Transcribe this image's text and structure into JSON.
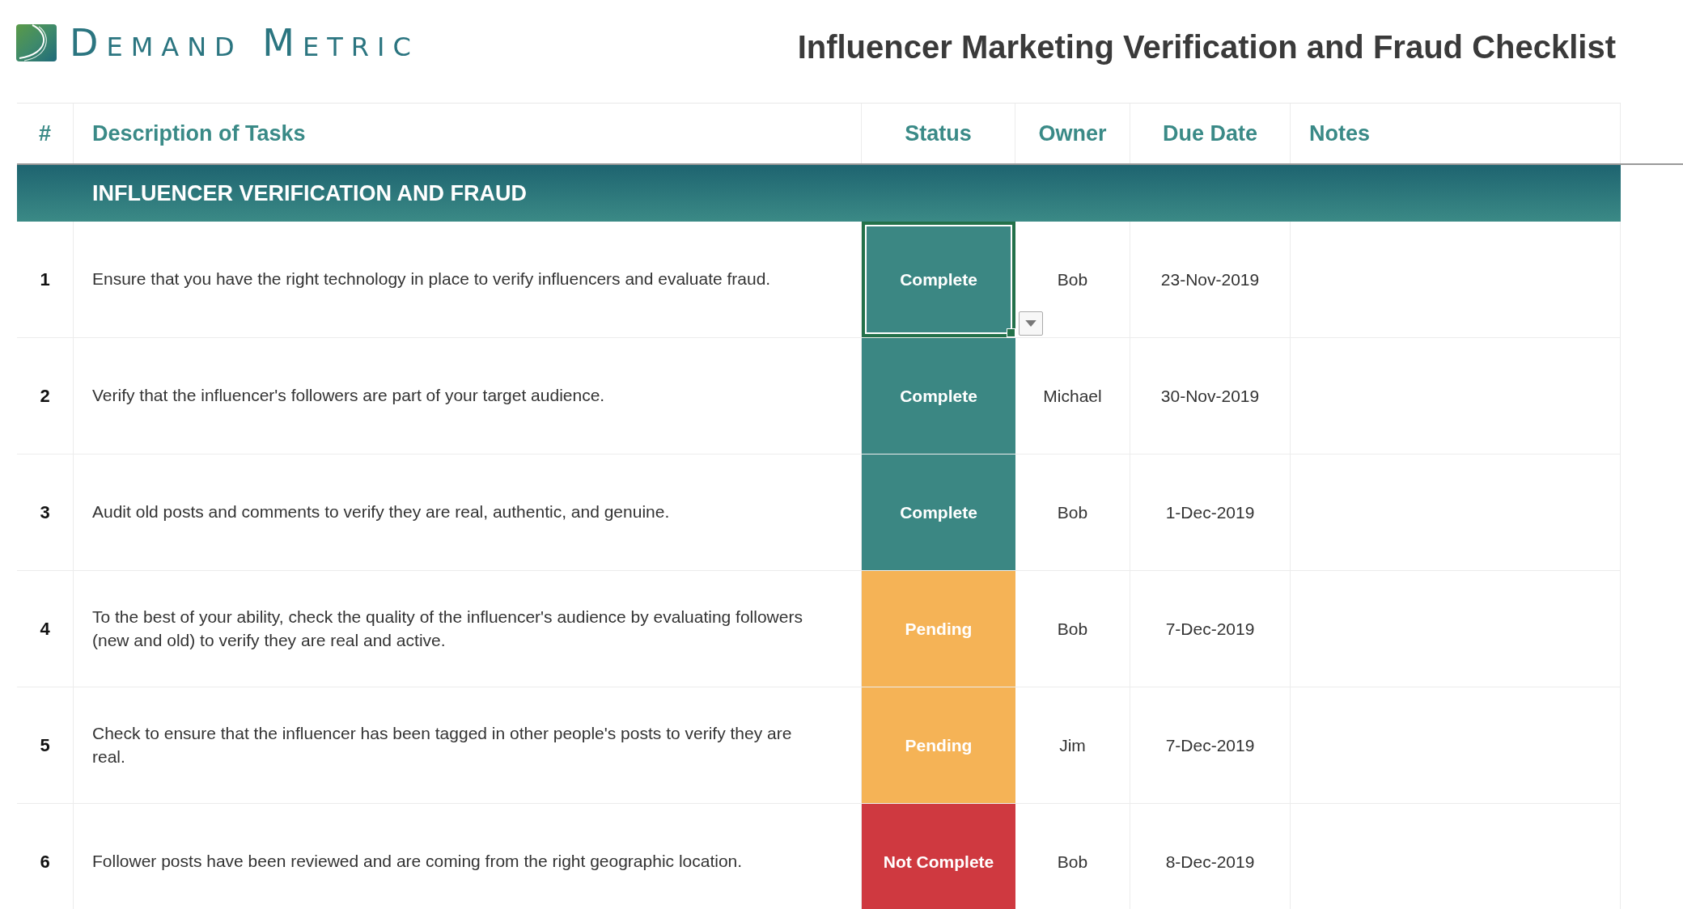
{
  "logo": {
    "text": "Demand Metric"
  },
  "title": "Influencer Marketing Verification and Fraud Checklist",
  "columns": [
    "#",
    "Description of Tasks",
    "Status",
    "Owner",
    "Due Date",
    "Notes"
  ],
  "section": "INFLUENCER VERIFICATION AND FRAUD",
  "rows": [
    {
      "number": "1",
      "task": "Ensure that you have the right technology in place to verify influencers and evaluate fraud.",
      "status": "Complete",
      "kind": "complete",
      "selected": true,
      "owner": "Bob",
      "due": "23-Nov-2019"
    },
    {
      "number": "2",
      "task": "Verify that the influencer's followers are part of your target audience.",
      "status": "Complete",
      "kind": "complete",
      "selected": false,
      "owner": "Michael",
      "due": "30-Nov-2019"
    },
    {
      "number": "3",
      "task": "Audit old posts and comments to verify they are real, authentic, and genuine.",
      "status": "Complete",
      "kind": "complete",
      "selected": false,
      "owner": "Bob",
      "due": "1-Dec-2019"
    },
    {
      "number": "4",
      "task": "To the best of your ability, check the quality of the influencer's audience by evaluating followers (new and old) to verify they are real and active.",
      "status": "Pending",
      "kind": "pending",
      "selected": false,
      "owner": "Bob",
      "due": "7-Dec-2019"
    },
    {
      "number": "5",
      "task": "Check to ensure that the influencer has been tagged in other people's posts to verify they are real.",
      "status": "Pending",
      "kind": "pending",
      "selected": false,
      "owner": "Jim",
      "due": "7-Dec-2019"
    },
    {
      "number": "6",
      "task": "Follower posts have been reviewed and are coming from the right geographic location.",
      "status": "Not Complete",
      "kind": "not_complete",
      "selected": false,
      "owner": "Bob",
      "due": "8-Dec-2019"
    }
  ]
}
